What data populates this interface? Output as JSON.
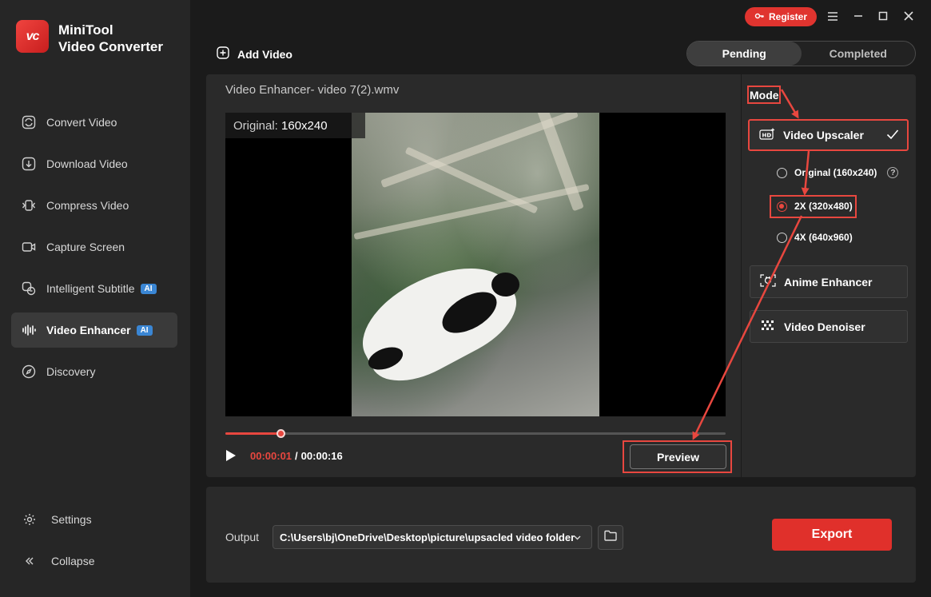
{
  "app": {
    "name_line1": "MiniTool",
    "name_line2": "Video Converter",
    "logo_text": "vc"
  },
  "sidebar": {
    "items": [
      {
        "label": "Convert Video",
        "icon": "convert-icon"
      },
      {
        "label": "Download Video",
        "icon": "download-icon"
      },
      {
        "label": "Compress Video",
        "icon": "compress-icon"
      },
      {
        "label": "Capture Screen",
        "icon": "camera-icon"
      },
      {
        "label": "Intelligent Subtitle",
        "icon": "subtitle-icon",
        "badge": "AI"
      },
      {
        "label": "Video Enhancer",
        "icon": "waveform-icon",
        "badge": "AI",
        "active": true
      },
      {
        "label": "Discovery",
        "icon": "compass-icon"
      }
    ],
    "settings_label": "Settings",
    "collapse_label": "Collapse"
  },
  "topbar": {
    "register_label": "Register",
    "add_video_label": "Add Video",
    "tabs": [
      {
        "label": "Pending",
        "active": true
      },
      {
        "label": "Completed",
        "active": false
      }
    ]
  },
  "player": {
    "title": "Video Enhancer- video 7(2).wmv",
    "original_label": "Original:",
    "original_size": "160x240",
    "current_time": "00:00:01",
    "separator": "/",
    "total_time": "00:00:16",
    "progress": 0.11,
    "preview_label": "Preview"
  },
  "modes": {
    "mode_label": "Mode",
    "upscaler_label": "Video Upscaler",
    "options": [
      {
        "label": "Original (160x240)",
        "selected": false,
        "help": "?"
      },
      {
        "label": "2X (320x480)",
        "selected": true
      },
      {
        "label": "4X (640x960)",
        "selected": false
      }
    ],
    "anime_label": "Anime Enhancer",
    "denoiser_label": "Video Denoiser"
  },
  "output": {
    "label": "Output",
    "path": "C:\\Users\\bj\\OneDrive\\Desktop\\picture\\upsacled video folder",
    "export_label": "Export"
  },
  "colors": {
    "accent": "#e8473f",
    "export": "#e0302b",
    "ai_badge": "#3a86d4"
  }
}
